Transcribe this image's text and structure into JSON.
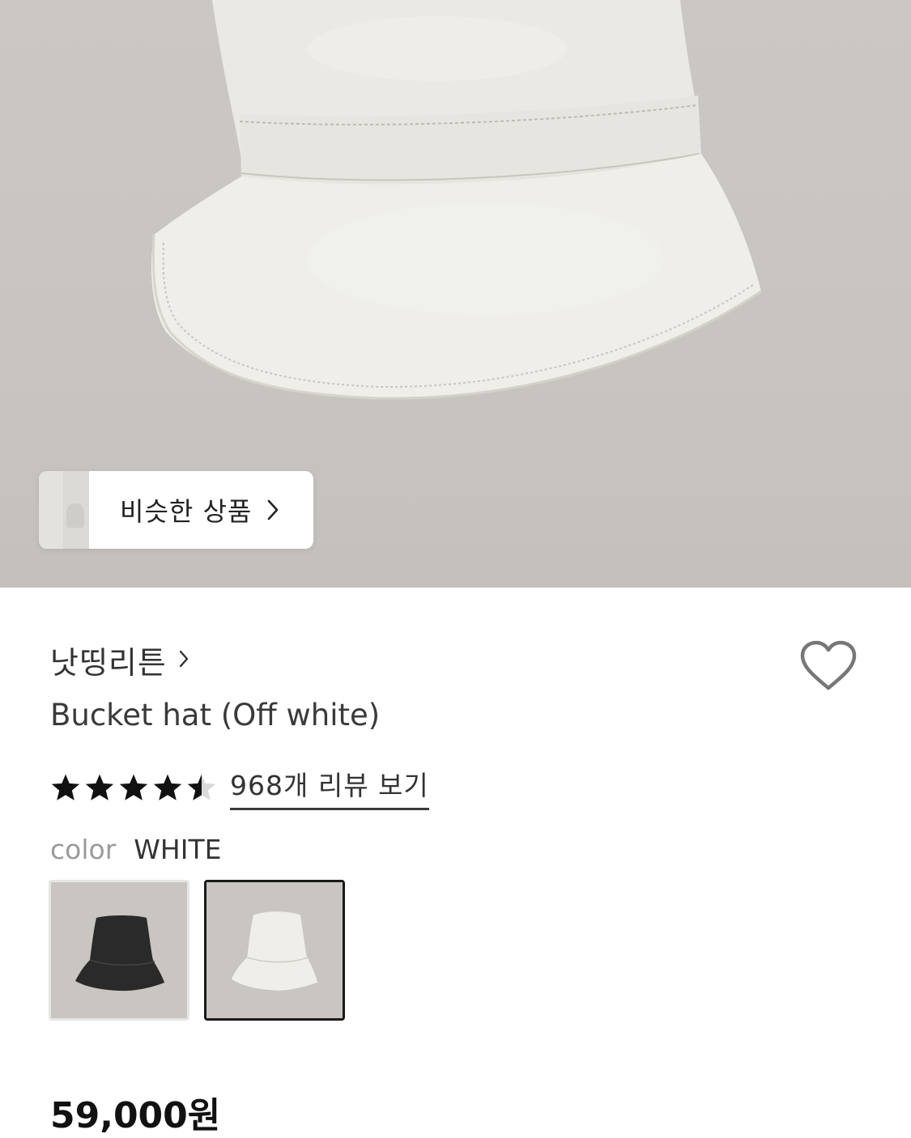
{
  "hero": {
    "alt": "Bucket hat product photo"
  },
  "similar": {
    "label": "비슷한 상품"
  },
  "brand": {
    "name": "낫띵리튼"
  },
  "product": {
    "title": "Bucket hat (Off white)",
    "price": "59,000원"
  },
  "rating": {
    "stars": 4.5,
    "reviews_label": "968개 리뷰 보기"
  },
  "color": {
    "key": "color",
    "value": "WHITE"
  },
  "swatches": [
    {
      "name": "black",
      "selected": false
    },
    {
      "name": "white",
      "selected": true
    }
  ],
  "icons": {
    "wishlist": "heart-outline-icon",
    "brand_chevron": "chevron-right-icon",
    "similar_chevron": "chevron-right-icon",
    "star": "star-icon"
  },
  "colors": {
    "text": "#222222",
    "muted": "#9a9a9a",
    "hero_bg": "#c9c5c1",
    "selected_border": "#1a1a1a"
  }
}
